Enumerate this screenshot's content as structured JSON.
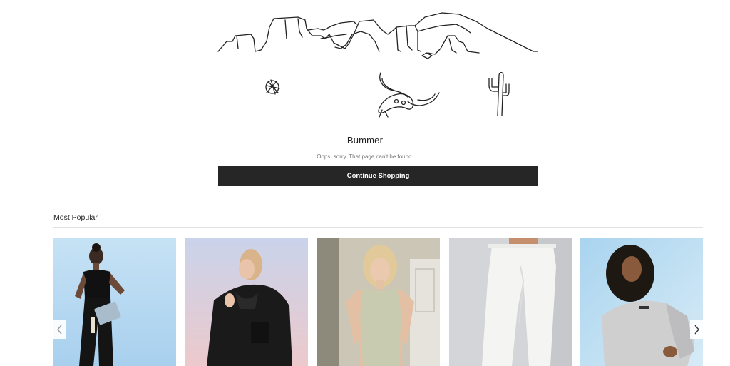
{
  "error": {
    "title": "Bummer",
    "message": "Oops, sorry. That page can't be found.",
    "cta_label": "Continue Shopping"
  },
  "most_popular": {
    "heading": "Most Popular",
    "products": [
      {
        "background": "#bcdcf2",
        "outfit": "black crop top and cargo pants"
      },
      {
        "background": "#dfd0de",
        "outfit": "black fleece jacket"
      },
      {
        "background": "#c9c5b8",
        "outfit": "sage knit tank top"
      },
      {
        "background": "#d6d8da",
        "outfit": "white joggers"
      },
      {
        "background": "#b7d9ef",
        "outfit": "grey hoodie"
      }
    ]
  },
  "icons": {
    "carousel_prev": "chevron-left-icon",
    "carousel_next": "chevron-right-icon"
  }
}
